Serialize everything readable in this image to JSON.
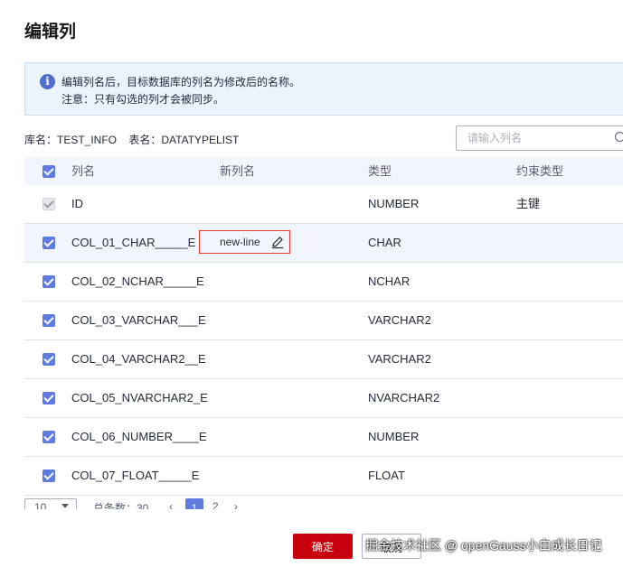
{
  "dialog": {
    "title": "编辑列"
  },
  "notice": {
    "icon": "info-icon",
    "line1": "编辑列名后，目标数据库的列名为修改后的名称。",
    "line2": "注意：只有勾选的列才会被同步。"
  },
  "meta": {
    "db": "库名：TEST_INFO",
    "table": "表名：DATATYPELIST"
  },
  "search": {
    "placeholder": "请输入列名"
  },
  "table": {
    "headers": {
      "name": "列名",
      "new_name": "新列名",
      "type": "类型",
      "constraint": "约束类型"
    },
    "rows": [
      {
        "name": "ID",
        "new_name": "",
        "type": "NUMBER",
        "constraint": "主键",
        "checked": true,
        "disabled": true
      },
      {
        "name": "COL_01_CHAR_____E",
        "new_name": "new-line",
        "type": "CHAR",
        "constraint": "",
        "checked": true
      },
      {
        "name": "COL_02_NCHAR_____E",
        "new_name": "",
        "type": "NCHAR",
        "constraint": "",
        "checked": true
      },
      {
        "name": "COL_03_VARCHAR___E",
        "new_name": "",
        "type": "VARCHAR2",
        "constraint": "",
        "checked": true
      },
      {
        "name": "COL_04_VARCHAR2__E",
        "new_name": "",
        "type": "VARCHAR2",
        "constraint": "",
        "checked": true
      },
      {
        "name": "COL_05_NVARCHAR2_E",
        "new_name": "",
        "type": "NVARCHAR2",
        "constraint": "",
        "checked": true
      },
      {
        "name": "COL_06_NUMBER____E",
        "new_name": "",
        "type": "NUMBER",
        "constraint": "",
        "checked": true
      },
      {
        "name": "COL_07_FLOAT_____E",
        "new_name": "",
        "type": "FLOAT",
        "constraint": "",
        "checked": true
      }
    ]
  },
  "pager": {
    "page_size": "10",
    "total": "总条数：30",
    "page1": "1",
    "page2": "2"
  },
  "buttons": {
    "ok": "确定",
    "cancel": "取消"
  },
  "watermark": "掘金技术社区 @ openGauss小白成长日记"
}
